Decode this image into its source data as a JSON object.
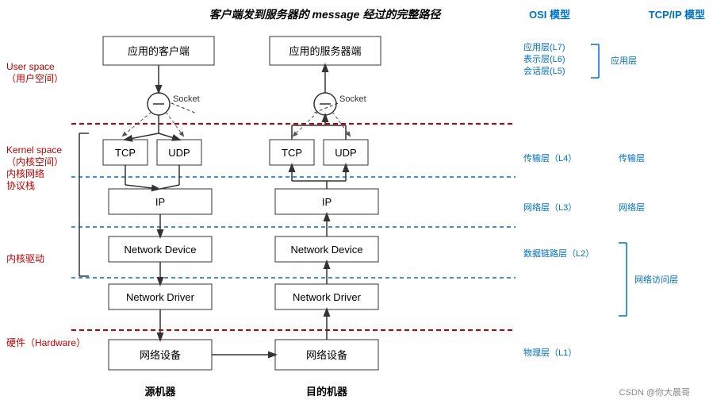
{
  "title": {
    "prefix": "客户端发到服务器的",
    "middle": " message ",
    "suffix": "经过的完整路径"
  },
  "osi_header": "OSI 模型",
  "tcpip_header": "TCP/IP 模型",
  "left_labels": {
    "user_space": "User space\n（用户空间）",
    "kernel_space": "Kernel space\n（内核空间）",
    "kernel_network": "内核网络\n协议栈",
    "kernel_driver": "内核驱动",
    "hardware": "硬件（Hardware）"
  },
  "client_side": {
    "app": "应用的客户端",
    "socket_label": "Socket",
    "tcp": "TCP",
    "udp": "UDP",
    "ip": "IP",
    "network_device": "Network Device",
    "network_driver": "Network Driver",
    "hw": "网络设备",
    "bottom_label": "源机器"
  },
  "server_side": {
    "app": "应用的服务器端",
    "socket_label": "Socket",
    "tcp": "TCP",
    "udp": "UDP",
    "ip": "IP",
    "network_device": "Network Device",
    "network_driver": "Network Driver",
    "hw": "网络设备",
    "bottom_label": "目的机器"
  },
  "osi_layers": {
    "app_layers": "应用层(L7)\n表示层(L6)\n会话层(L5)",
    "transport": "传输层（L4）",
    "network": "网络层（L3）",
    "datalink": "数据链路层（L2）",
    "physical": "物理层（L1）"
  },
  "tcpip_layers": {
    "app": "应用层",
    "transport": "传输层",
    "network": "网络层",
    "netaccess": "网络访问层"
  },
  "bottom_csdn": "CSDN @你大晨哥"
}
